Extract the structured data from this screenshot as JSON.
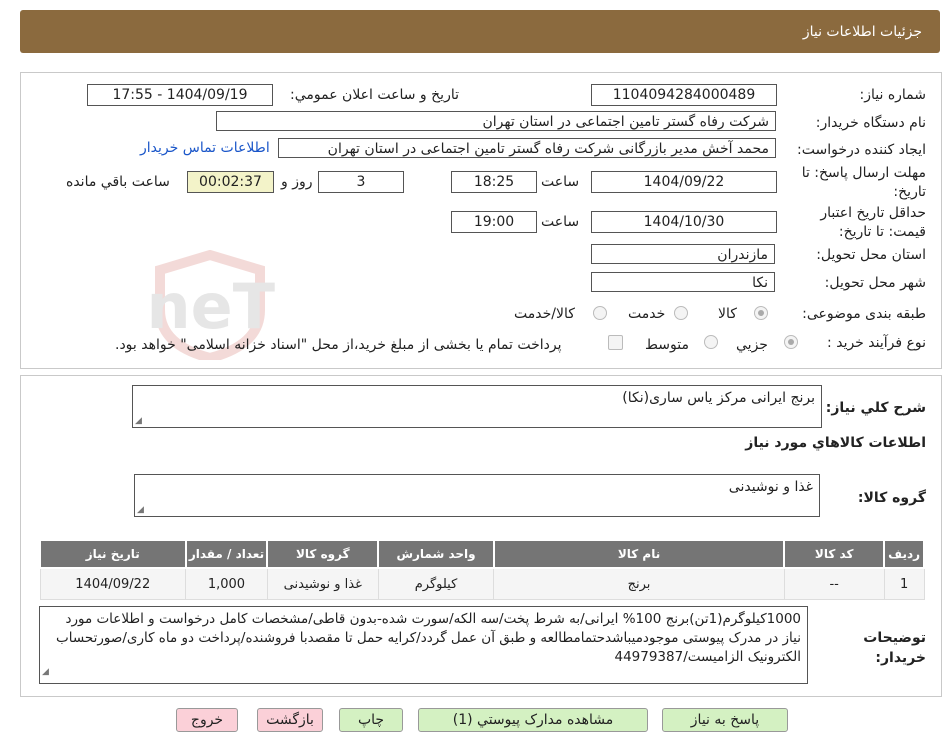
{
  "header": {
    "title": "جزئیات اطلاعات نیاز"
  },
  "labels": {
    "need_number": "شماره نیاز:",
    "announce_datetime": "تاریخ و ساعت اعلان عمومي:",
    "buyer_org": "نام دستگاه خريدار:",
    "requester": "ایجاد کننده درخواست:",
    "contact_link": "اطلاعات تماس خریدار",
    "deadline": "مهلت ارسال پاسخ: تا تاریخ:",
    "time": "ساعت",
    "day_and": "روز و",
    "remaining": "ساعت باقي مانده",
    "validity": "حداقل تاریخ اعتبار قیمت: تا تاریخ:",
    "time2": "ساعت",
    "province": "استان محل تحویل:",
    "city": "شهر محل تحویل:",
    "category": "طبقه بندی موضوعی:",
    "process_type": "نوع فرآیند خرید :"
  },
  "fields": {
    "need_number": "1104094284000489",
    "announce_datetime": "1404/09/19 - 17:55",
    "buyer_org": "شرکت رفاه گستر تامین اجتماعی در استان تهران",
    "requester": "محمد آخش مدیر بازرگانی شرکت رفاه گستر تامین اجتماعی در استان تهران",
    "deadline_date": "1404/09/22",
    "deadline_time": "18:25",
    "days": "3",
    "timer": "00:02:37",
    "validity_date": "1404/10/30",
    "validity_time": "19:00",
    "province": "مازندران",
    "city": "نکا"
  },
  "category_options": [
    "کالا",
    "خدمت",
    "کالا/خدمت"
  ],
  "process_options": [
    "جزیي",
    "متوسط"
  ],
  "payment_note": "پرداخت تمام یا بخشی از مبلغ خرید،از محل \"اسناد خزانه اسلامی\" خواهد بود.",
  "general_desc": {
    "label": "شرح کلي نیاز:",
    "value": "برنج ایرانی مرکز یاس ساری(نکا)"
  },
  "goods_section": {
    "title": "اطلاعات کالاهاي مورد نیاز",
    "group_label": "گروه کالا:",
    "group_value": "غذا و نوشیدنی"
  },
  "table": {
    "headers": [
      "ردیف",
      "کد کالا",
      "نام کالا",
      "واحد شمارش",
      "گروه کالا",
      "تعداد / مقدار",
      "تاریخ نیاز"
    ],
    "rows": [
      [
        "1",
        "--",
        "برنج",
        "کیلوگرم",
        "غذا و نوشیدنی",
        "1,000",
        "1404/09/22"
      ]
    ]
  },
  "buyer_notes": {
    "label": "توضیحات خریدار:",
    "value": "1000کیلوگرم(1تن)برنج 100% ایرانی/به شرط پخت/سه الکه/سورت شده-بدون قاطی/مشخصات کامل درخواست و اطلاعات مورد نیاز در مدرک پیوستی موجودمیباشدحتمامطالعه و طبق آن عمل گردد/کرایه حمل تا مقصدبا فروشنده/پرداخت دو ماه کاری/صورتحساب الکترونیک الزامیست/44979387"
  },
  "buttons": {
    "reply": "پاسخ به نیاز",
    "attachments": "مشاهده مدارک پیوستي (1)",
    "print": "چاپ",
    "back": "بازگشت",
    "exit": "خروج"
  },
  "watermark": "AriaTender.neT",
  "colors": {
    "header_bg": "#8b6a3e",
    "table_header": "#757575",
    "timer_bg": "#f3f3c9",
    "btn_green": "#d4f1c2",
    "btn_pink": "#fbd0d8",
    "link": "#1a56c9"
  }
}
